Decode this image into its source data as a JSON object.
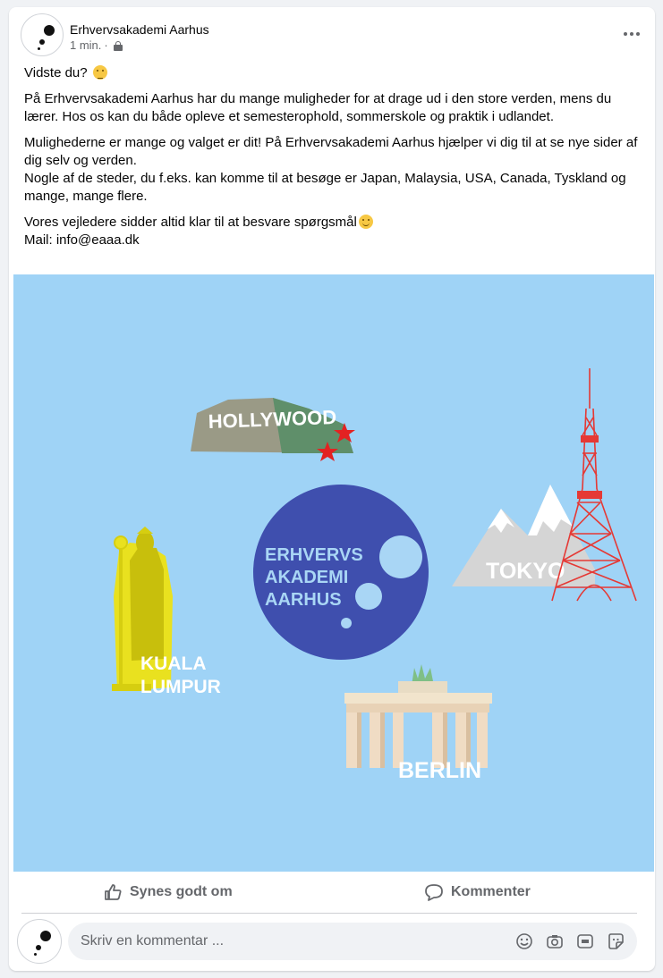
{
  "post": {
    "page_name": "Erhvervsakademi Aarhus",
    "timestamp": "1 min.",
    "separator": "·",
    "paragraphs": [
      "Vidste du?",
      "På Erhvervsakademi Aarhus har du mange muligheder for at drage ud i den store verden, mens du lærer. Hos os kan du både opleve et semesterophold, sommerskole og praktik i udlandet.",
      "Mulighederne er mange og valget er dit! På Erhvervsakademi Aarhus hjælper vi dig til at se nye sider af dig selv og verden.",
      "Nogle af de steder, du f.eks. kan komme til at besøge er Japan, Malaysia, USA, Canada, Tyskland og mange, mange flere.",
      "Vores vejledere sidder altid klar til at besvare spørgsmål",
      "Mail: info@eaaa.dk"
    ]
  },
  "image": {
    "logo_lines": [
      "ERHVERVS",
      "AKADEMI",
      "AARHUS"
    ],
    "hollywood": "HOLLYWOOD",
    "tokyo": "TOKYO",
    "kuala": "KUALA",
    "lumpur": "LUMPUR",
    "berlin": "BERLIN",
    "colors": {
      "sky": "#9fd3f6",
      "logo_circle": "#3f4fae",
      "logo_text": "#a9d6f5",
      "tower_red": "#e53935",
      "statue_yellow": "#e9e11f"
    }
  },
  "actions": {
    "like_label": "Synes godt om",
    "comment_label": "Kommenter"
  },
  "comment": {
    "placeholder": "Skriv en kommentar ..."
  },
  "icons": {
    "emoji_thinking": "thinking-face-icon",
    "emoji_smile": "smiling-face-icon",
    "lock": "lock-icon",
    "like": "thumbs-up-icon",
    "comment": "speech-bubble-icon",
    "inputs": [
      "emoji-icon",
      "camera-icon",
      "gif-icon",
      "sticker-icon"
    ]
  }
}
